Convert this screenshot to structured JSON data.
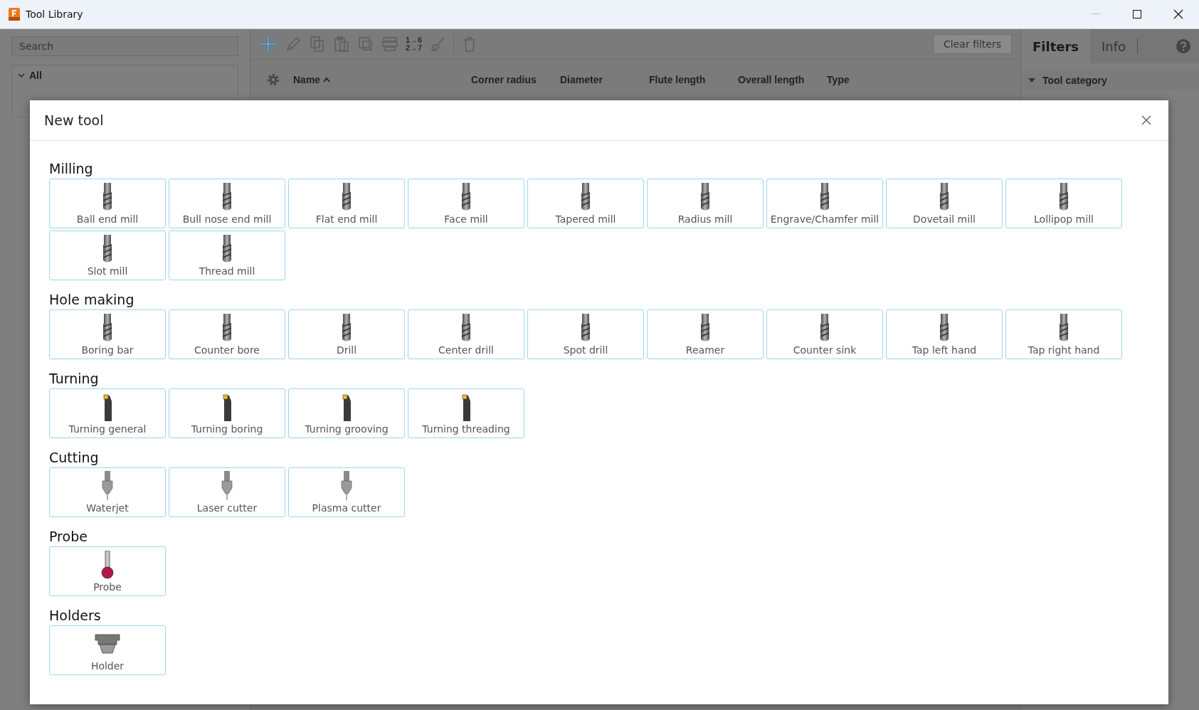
{
  "window": {
    "title": "Tool Library"
  },
  "search": {
    "placeholder": "Search"
  },
  "tree": [
    {
      "label": "All",
      "expanded": true
    }
  ],
  "toolbar": {
    "renumber_label": "1→6\n2→7",
    "clear_filters": {
      "label": "Clear filters",
      "disabled": true
    }
  },
  "table": {
    "columns": [
      {
        "label": "Name",
        "sorted": true
      },
      {
        "label": "Corner radius",
        "sorted": false
      },
      {
        "label": "Diameter",
        "sorted": false
      },
      {
        "label": "Flute length",
        "sorted": false
      },
      {
        "label": "Overall length",
        "sorted": false
      },
      {
        "label": "Type",
        "sorted": false
      }
    ]
  },
  "side_tabs": [
    {
      "label": "Filters",
      "selected": true
    },
    {
      "label": "Info",
      "selected": false
    }
  ],
  "filters": [
    {
      "label": "Tool category",
      "expanded": true
    }
  ],
  "dialog": {
    "title": "New tool",
    "sections": [
      {
        "title": "Milling",
        "kind": "mill",
        "tools": [
          "Ball end mill",
          "Bull nose end mill",
          "Flat end mill",
          "Face mill",
          "Tapered mill",
          "Radius mill",
          "Engrave/Chamfer mill",
          "Dovetail mill",
          "Lollipop mill",
          "Slot mill",
          "Thread mill"
        ]
      },
      {
        "title": "Hole making",
        "kind": "mill",
        "tools": [
          "Boring bar",
          "Counter bore",
          "Drill",
          "Center drill",
          "Spot drill",
          "Reamer",
          "Counter sink",
          "Tap left hand",
          "Tap right hand"
        ]
      },
      {
        "title": "Turning",
        "kind": "turning",
        "tools": [
          "Turning general",
          "Turning boring",
          "Turning grooving",
          "Turning threading"
        ]
      },
      {
        "title": "Cutting",
        "kind": "nozzle",
        "tools": [
          "Waterjet",
          "Laser cutter",
          "Plasma cutter"
        ]
      },
      {
        "title": "Probe",
        "kind": "probe",
        "tools": [
          "Probe"
        ]
      },
      {
        "title": "Holders",
        "kind": "holder",
        "tools": [
          "Holder"
        ]
      }
    ]
  }
}
